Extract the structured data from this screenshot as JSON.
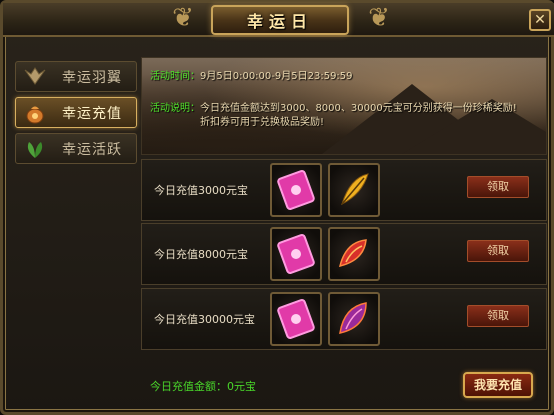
{
  "window": {
    "title": "幸运日",
    "close_label": "✕"
  },
  "sidebar": {
    "items": [
      {
        "label": "幸运羽翼",
        "icon": "wings-icon",
        "active": false
      },
      {
        "label": "幸运充值",
        "icon": "money-bag-icon",
        "active": true
      },
      {
        "label": "幸运活跃",
        "icon": "leaf-icon",
        "active": false
      }
    ]
  },
  "banner": {
    "time_key": "活动时间：",
    "time_value": "9月5日0:00:00-9月5日23:59:59",
    "desc_key": "活动说明：",
    "desc_line1": "今日充值金额达到3000、8000、30000元宝可分别获得一份珍稀奖励!",
    "desc_line2": "折扣券可用于兑换极品奖励!"
  },
  "rewards": [
    {
      "label": "今日充值3000元宝",
      "claim": "领取",
      "items": [
        "coupon-icon",
        "feather-icon"
      ]
    },
    {
      "label": "今日充值8000元宝",
      "claim": "领取",
      "items": [
        "coupon-icon",
        "red-wing-icon"
      ]
    },
    {
      "label": "今日充值30000元宝",
      "claim": "领取",
      "items": [
        "coupon-icon",
        "purple-wing-icon"
      ]
    }
  ],
  "footer": {
    "total_label": "今日充值金额：0元宝",
    "recharge_button": "我要充值"
  },
  "colors": {
    "accent_gold": "#c9a45a",
    "highlight_green": "#49d62a",
    "button_red": "#8a2f1a"
  }
}
